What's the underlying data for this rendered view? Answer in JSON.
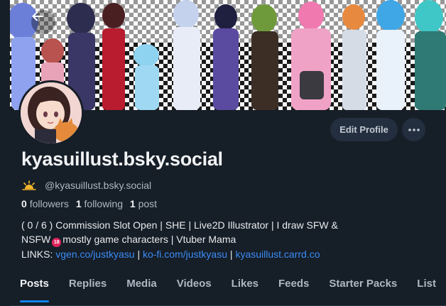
{
  "profile": {
    "display_name": "kyasuillust.bsky.social",
    "handle": "@kyasuillust.bsky.social",
    "handle_icon": "sun-icon",
    "followers_count": "0",
    "followers_label": "followers",
    "following_count": "1",
    "following_label": "following",
    "posts_count": "1",
    "posts_label": "post",
    "edit_button_label": "Edit Profile",
    "more_button": "ellipsis-icon"
  },
  "bio": {
    "line1": "( 0 / 6 ) Commission Slot Open | SHE | Live2D Illustrator | I draw SFW &",
    "line2_before": "NSFW",
    "nsfw_badge": "18",
    "line2_after": "mostly game characters | Vtuber Mama",
    "links_label": "LINKS:",
    "link1": "vgen.co/justkyasu",
    "sep1": "|",
    "link2": "ko-fi.com/justkyasu",
    "sep2": "|",
    "link3": "kyasuillust.carrd.co"
  },
  "tabs": [
    {
      "label": "Posts",
      "active": true
    },
    {
      "label": "Replies"
    },
    {
      "label": "Media"
    },
    {
      "label": "Videos"
    },
    {
      "label": "Likes"
    },
    {
      "label": "Feeds"
    },
    {
      "label": "Starter Packs"
    },
    {
      "label": "List"
    }
  ],
  "colors": {
    "background": "#161e27",
    "accent": "#1083fe",
    "link": "#3b8cf6",
    "button_bg": "#232e3e"
  }
}
